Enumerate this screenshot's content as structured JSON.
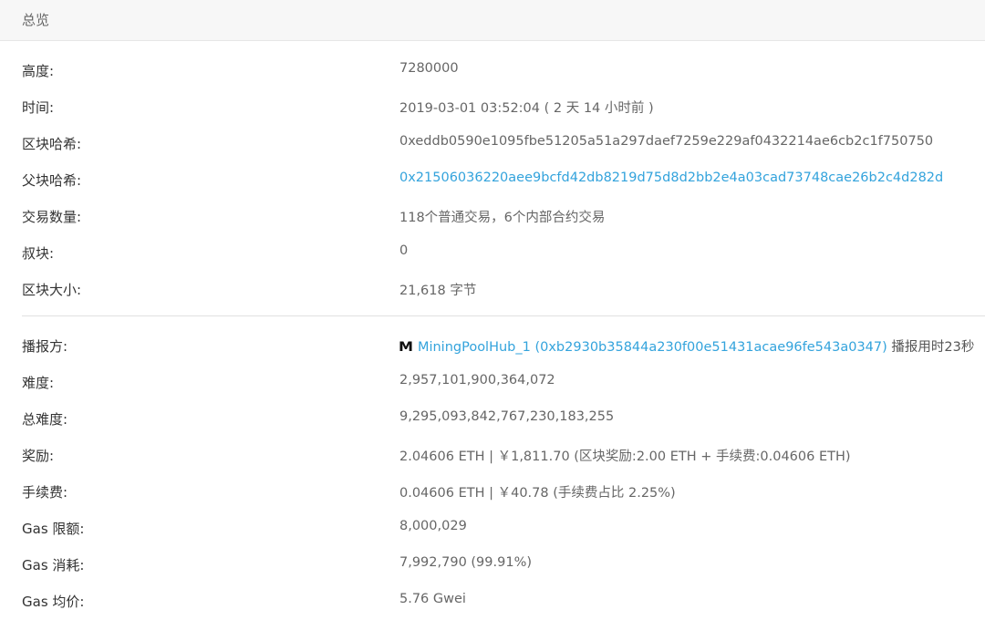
{
  "header": {
    "title": "总览"
  },
  "rows_top": [
    {
      "label": "高度:",
      "value": "7280000"
    },
    {
      "label": "时间:",
      "value": "2019-03-01 03:52:04 ( 2 天 14 小时前 )"
    },
    {
      "label": "区块哈希:",
      "value": "0xeddb0590e1095fbe51205a51a297daef7259e229af0432214ae6cb2c1f750750"
    },
    {
      "label": "父块哈希:",
      "value": "0x21506036220aee9bcfd42db8219d75d8d2bb2e4a03cad73748cae26b2c4d282d"
    },
    {
      "label": "交易数量:",
      "value": "118个普通交易，6个内部合约交易"
    },
    {
      "label": "叔块:",
      "value": "0"
    },
    {
      "label": "区块大小:",
      "value": "21,618 字节"
    }
  ],
  "miner": {
    "label": "播报方:",
    "icon_letter": "M",
    "name_link": "MiningPoolHub_1 (0xb2930b35844a230f00e51431acae96fe543a0347)",
    "suffix": " 播报用时23秒"
  },
  "rows_bottom": [
    {
      "label": "难度:",
      "value": "2,957,101,900,364,072"
    },
    {
      "label": "总难度:",
      "value": "9,295,093,842,767,230,183,255"
    },
    {
      "label": "奖励:",
      "value": "2.04606 ETH | ￥1,811.70 (区块奖励:2.00 ETH + 手续费:0.04606 ETH)"
    },
    {
      "label": "手续费:",
      "value": "0.04606 ETH | ￥40.78 (手续费占比 2.25%)"
    },
    {
      "label": "Gas 限额:",
      "value": "8,000,029"
    },
    {
      "label": "Gas 消耗:",
      "value": "7,992,790 (99.91%)"
    },
    {
      "label": "Gas 均价:",
      "value": "5.76 Gwei"
    }
  ],
  "colors": {
    "link": "#33a3dc",
    "label": "#333333",
    "value": "#666666"
  }
}
